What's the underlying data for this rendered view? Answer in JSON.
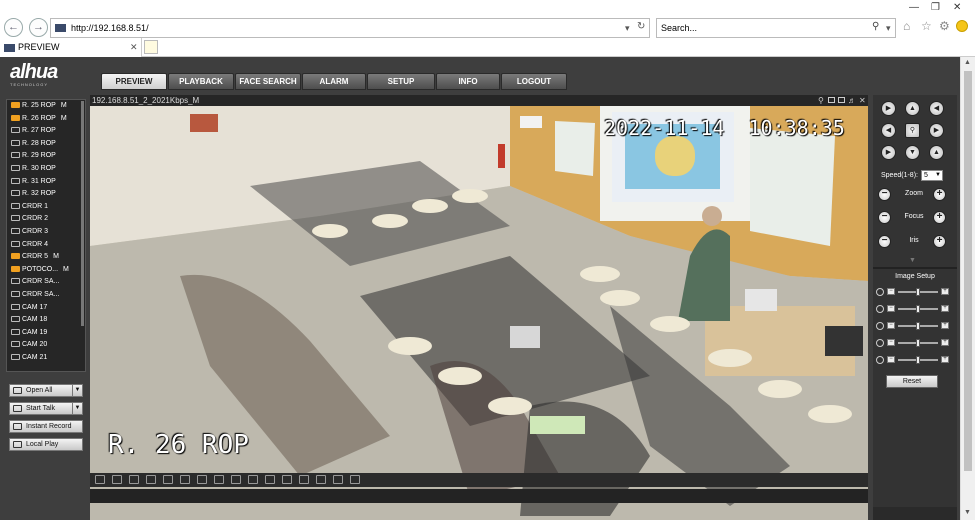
{
  "browser": {
    "url": "http://192.168.8.51/",
    "search_placeholder": "Search...",
    "tab_title": "PREVIEW"
  },
  "brand": {
    "logo": "alhua",
    "tagline": "TECHNOLOGY"
  },
  "nav": {
    "tabs": [
      "PREVIEW",
      "PLAYBACK",
      "FACE SEARCH",
      "ALARM",
      "SETUP",
      "INFO",
      "LOGOUT"
    ],
    "active": "PREVIEW"
  },
  "channels": [
    {
      "name": "R. 25 ROP",
      "active": true,
      "flag": "M"
    },
    {
      "name": "R. 26 ROP",
      "active": true,
      "flag": "M"
    },
    {
      "name": "R. 27 ROP",
      "active": false,
      "flag": ""
    },
    {
      "name": "R. 28 ROP",
      "active": false,
      "flag": ""
    },
    {
      "name": "R. 29 ROP",
      "active": false,
      "flag": ""
    },
    {
      "name": "R. 30 ROP",
      "active": false,
      "flag": ""
    },
    {
      "name": "R. 31 ROP",
      "active": false,
      "flag": ""
    },
    {
      "name": "R. 32 ROP",
      "active": false,
      "flag": ""
    },
    {
      "name": "CRDR 1",
      "active": false,
      "flag": ""
    },
    {
      "name": "CRDR 2",
      "active": false,
      "flag": ""
    },
    {
      "name": "CRDR 3",
      "active": false,
      "flag": ""
    },
    {
      "name": "CRDR 4",
      "active": false,
      "flag": ""
    },
    {
      "name": "CRDR 5",
      "active": true,
      "flag": "M"
    },
    {
      "name": "POTOCO...",
      "active": true,
      "flag": "M"
    },
    {
      "name": "CRDR SA...",
      "active": false,
      "flag": ""
    },
    {
      "name": "CRDR SA...",
      "active": false,
      "flag": ""
    },
    {
      "name": "CAM 17",
      "active": false,
      "flag": ""
    },
    {
      "name": "CAM 18",
      "active": false,
      "flag": ""
    },
    {
      "name": "CAM 19",
      "active": false,
      "flag": ""
    },
    {
      "name": "CAM 20",
      "active": false,
      "flag": ""
    },
    {
      "name": "CAM 21",
      "active": false,
      "flag": ""
    }
  ],
  "left_buttons": {
    "open_all": "Open All",
    "start_talk": "Start Talk",
    "instant_record": "Instant Record",
    "local_play": "Local Play"
  },
  "video": {
    "stream_info": "192.168.8.51_2_2021Kbps_M",
    "timestamp": "2022-11-14  10:38:35",
    "channel_label": "R. 26 ROP"
  },
  "ptz": {
    "speed_label": "Speed(1-8):",
    "speed_value": "5",
    "zoom_label": "Zoom",
    "focus_label": "Focus",
    "iris_label": "Iris",
    "minus": "−",
    "plus": "+"
  },
  "image_setup": {
    "title": "Image Setup",
    "reset_label": "Reset",
    "sliders": [
      0.5,
      0.5,
      0.5,
      0.5,
      0.5
    ]
  }
}
